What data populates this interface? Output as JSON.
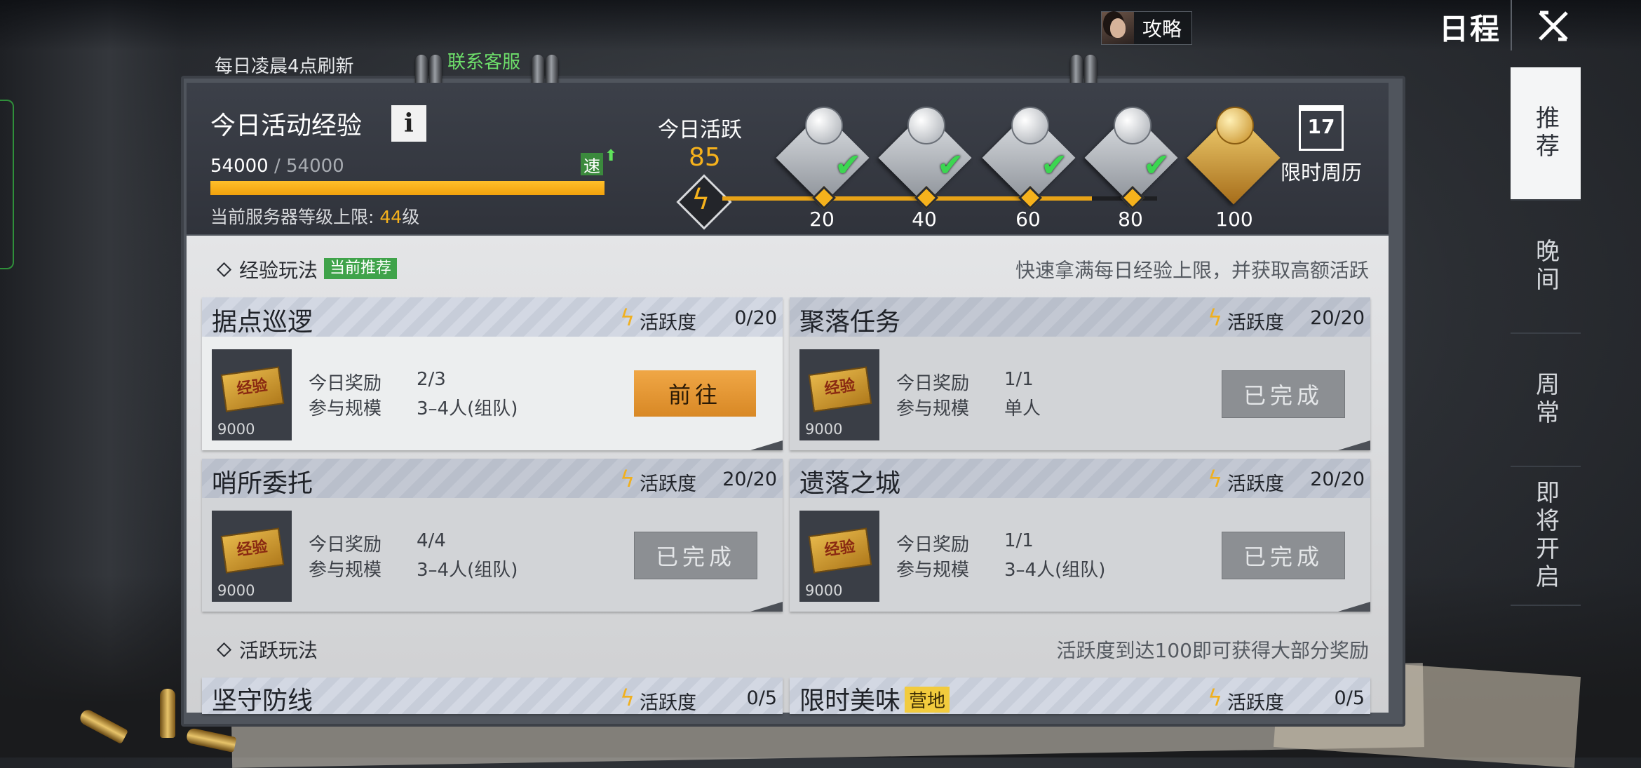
{
  "topbar": {
    "guide_label": "攻略",
    "title": "日程"
  },
  "side_tabs": [
    {
      "label": "推荐",
      "active": true
    },
    {
      "label": "晚间",
      "active": false
    },
    {
      "label": "周常",
      "active": false
    },
    {
      "label": "即将开启",
      "active": false
    }
  ],
  "board": {
    "refresh_note": "每日凌晨4点刷新",
    "support_link": "联系客服"
  },
  "exp": {
    "title": "今日活动经验",
    "info_label": "i",
    "current": "54000",
    "separator": "/",
    "max": "54000",
    "progress": 1.0,
    "speed_badge": "速",
    "server_cap_prefix": "当前服务器等级上限: ",
    "server_cap_level": "44",
    "server_cap_suffix": "级"
  },
  "activity": {
    "label": "今日活跃",
    "value": "85",
    "progress": 0.85,
    "milestones": [
      {
        "value": "20",
        "claimed": true,
        "chest": "silver"
      },
      {
        "value": "40",
        "claimed": true,
        "chest": "silver"
      },
      {
        "value": "60",
        "claimed": true,
        "chest": "silver"
      },
      {
        "value": "80",
        "claimed": true,
        "chest": "silver"
      },
      {
        "value": "100",
        "claimed": false,
        "chest": "gold"
      }
    ],
    "calendar_day": "17",
    "calendar_label": "限时周历"
  },
  "sections": {
    "exp_title": "经验玩法",
    "exp_tag": "当前推荐",
    "exp_note": "快速拿满每日经验上限，并获取高额活跃",
    "act_title": "活跃玩法",
    "act_note": "活跃度到达100即可获得大部分奖励"
  },
  "labels": {
    "activity": "活跃度",
    "reward_today": "今日奖励",
    "scale": "参与规模",
    "reward_item": "经验"
  },
  "exp_cards": [
    {
      "name": "据点巡逻",
      "activity": "0/20",
      "reward_qty": "9000",
      "reward_today": "2/3",
      "scale": "3–4人(组队)",
      "button": "前往",
      "state": "go"
    },
    {
      "name": "聚落任务",
      "activity": "20/20",
      "reward_qty": "9000",
      "reward_today": "1/1",
      "scale": "单人",
      "button": "已完成",
      "state": "done"
    },
    {
      "name": "哨所委托",
      "activity": "20/20",
      "reward_qty": "9000",
      "reward_today": "4/4",
      "scale": "3–4人(组队)",
      "button": "已完成",
      "state": "done"
    },
    {
      "name": "遗落之城",
      "activity": "20/20",
      "reward_qty": "9000",
      "reward_today": "1/1",
      "scale": "3–4人(组队)",
      "button": "已完成",
      "state": "done"
    }
  ],
  "act_cards": [
    {
      "name": "坚守防线",
      "activity": "0/5",
      "tag": ""
    },
    {
      "name": "限时美味",
      "activity": "0/5",
      "tag": "营地"
    }
  ],
  "colors": {
    "accent_orange": "#f6b21c",
    "complete_green": "#3cd651",
    "recommend_green": "#3fa34a",
    "go_button": "#f0a746"
  }
}
